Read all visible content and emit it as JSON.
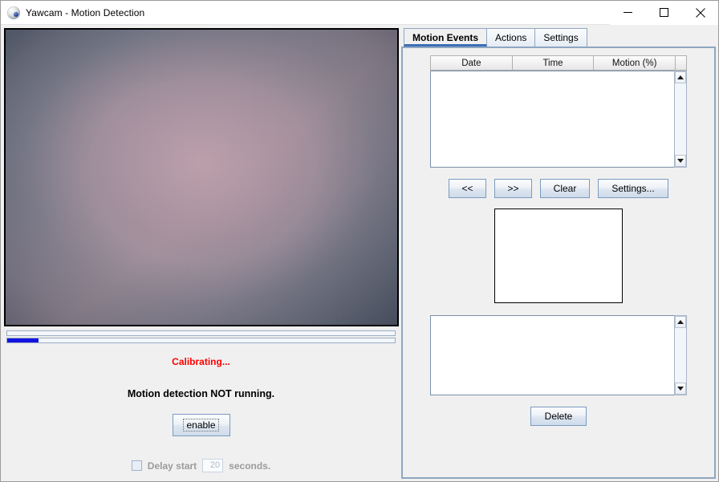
{
  "window": {
    "title": "Yawcam - Motion Detection",
    "icon": "webcam-ball-icon",
    "controls": {
      "minimize": "minimize-icon",
      "maximize": "maximize-icon",
      "close": "close-icon"
    }
  },
  "video": {
    "alt": "live-camera-feed",
    "progress_top_percent": 0,
    "progress_bottom_percent": 8
  },
  "status": {
    "calibrating": "Calibrating...",
    "calibrating_color": "#ff0000",
    "detection_state": "Motion detection NOT running.",
    "enable_label": "enable",
    "delay_label": "Delay start",
    "delay_value": "20",
    "delay_units": "seconds.",
    "delay_checked": false,
    "delay_enabled": false
  },
  "tabs": [
    {
      "label": "Motion Events",
      "active": true
    },
    {
      "label": "Actions",
      "active": false
    },
    {
      "label": "Settings",
      "active": false
    }
  ],
  "events_table": {
    "columns": [
      "Date",
      "Time",
      "Motion (%)"
    ],
    "rows": []
  },
  "toolbar": {
    "prev_label": "<<",
    "next_label": ">>",
    "clear_label": "Clear",
    "settings_label": "Settings..."
  },
  "preview": {
    "name": "motion-thumbnail-preview",
    "content": ""
  },
  "file_list": {
    "items": []
  },
  "actions": {
    "delete_label": "Delete"
  },
  "colors": {
    "accent": "#3b6fb5",
    "panel_bg": "#f0f0f0",
    "border": "#8fa6c0",
    "progress_fill": "#1414e0",
    "alert": "#ff0000"
  }
}
